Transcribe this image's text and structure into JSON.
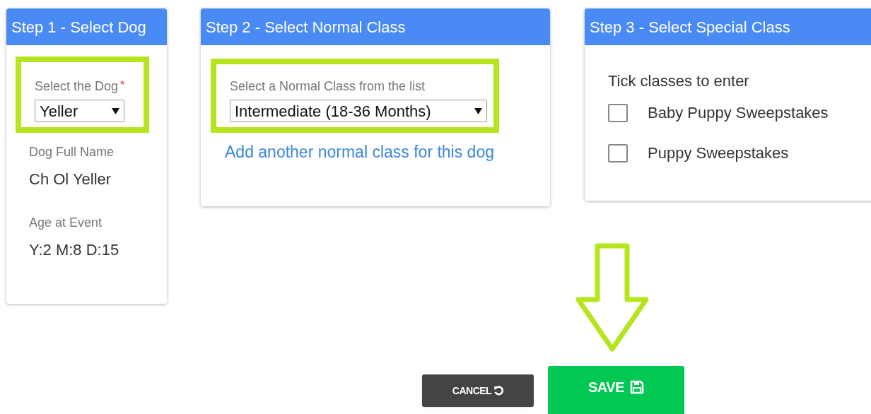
{
  "step1": {
    "title": "Step 1 - Select Dog",
    "select": {
      "label": "Select the Dog",
      "required_mark": "*",
      "value": "Yeller",
      "highlighted": true
    },
    "details": [
      {
        "label": "Dog Full Name",
        "value": "Ch Ol Yeller"
      },
      {
        "label": "Age at Event",
        "value": "Y:2 M:8 D:15"
      }
    ]
  },
  "step2": {
    "title": "Step 2 - Select Normal Class",
    "select": {
      "label": "Select a Normal Class from the list",
      "value": "Intermediate (18-36 Months)",
      "highlighted": true
    },
    "link": "Add another normal class for this dog"
  },
  "step3": {
    "title": "Step 3 - Select Special Class",
    "instruction": "Tick classes to enter",
    "classes": [
      {
        "label": "Baby Puppy Sweepstakes",
        "checked": false
      },
      {
        "label": "Puppy Sweepstakes",
        "checked": false
      }
    ]
  },
  "annotation_arrow": true,
  "buttons": [
    {
      "kind": "cancel",
      "label": "CANCEL"
    },
    {
      "kind": "save",
      "label": "SAVE"
    }
  ]
}
